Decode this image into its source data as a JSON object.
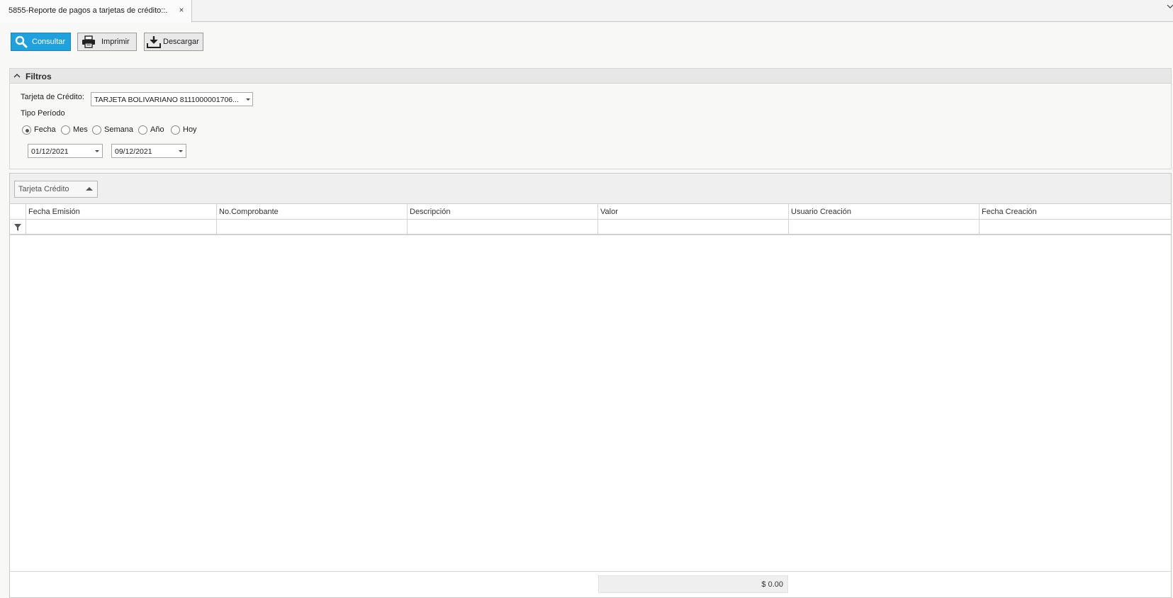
{
  "tab": {
    "title": "5855-Reporte de pagos a tarjetas de crédito::.",
    "close_glyph": "×"
  },
  "toolbar": {
    "consultar": "Consultar",
    "imprimir": "Imprimir",
    "descargar": "Descargar"
  },
  "filters": {
    "title": "Filtros",
    "card_label": "Tarjeta de Crédito:",
    "card_value": "TARJETA BOLIVARIANO 8111000001706...",
    "period_label": "Tipo Período",
    "period_options": [
      "Fecha",
      "Mes",
      "Semana",
      "Año",
      "Hoy"
    ],
    "selected_period": "Fecha",
    "date_from": "01/12/2021",
    "date_to": "09/12/2021"
  },
  "grid": {
    "group_by": "Tarjeta Crédito",
    "columns": [
      "Fecha Emisión",
      "No.Comprobante",
      "Descripción",
      "Valor",
      "Usuario Creación",
      "Fecha Creación"
    ],
    "rows": [],
    "total_valor": "$ 0.00"
  },
  "icons": {
    "consultar": "search-icon",
    "imprimir": "printer-icon",
    "descargar": "download-icon",
    "filters_toggle": "chevron-up-icon",
    "filter_row": "filter-icon",
    "tab_menu": "chevron-down-icon"
  },
  "colors": {
    "accent": "#1ea1dc"
  }
}
